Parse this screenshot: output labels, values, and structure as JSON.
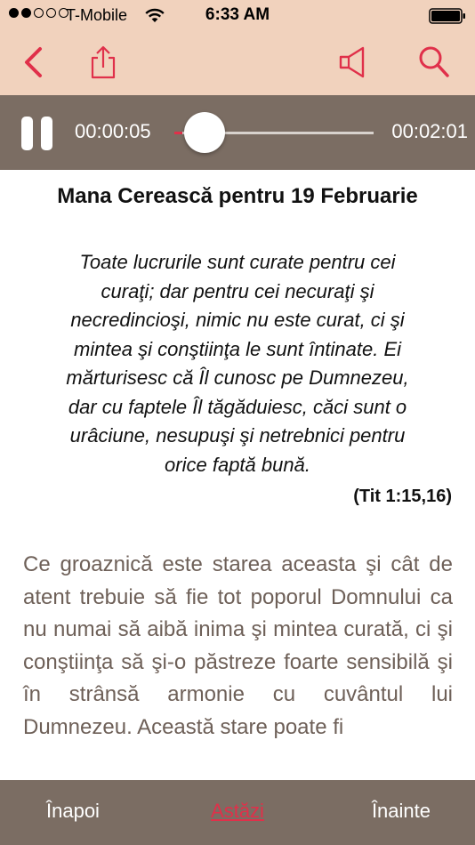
{
  "status_bar": {
    "carrier": "T-Mobile",
    "time": "6:33 AM",
    "signal_bars_filled": 2,
    "signal_bars_total": 5
  },
  "nav": {
    "icons": [
      "back-chevron-icon",
      "share-icon",
      "speaker-icon",
      "search-icon"
    ],
    "accent_color": "#e0304a"
  },
  "player": {
    "elapsed": "00:00:05",
    "duration": "00:02:01",
    "progress_fraction": 0.04
  },
  "article": {
    "title": "Mana Cerească pentru 19 Februarie",
    "verse_lines": [
      "Toate lucrurile sunt curate pentru cei",
      "curaţi; dar pentru cei necuraţi şi",
      "necredincioşi, nimic nu este curat, ci şi",
      "mintea şi conştiinţa le sunt întinate. Ei",
      "mărturisesc că Îl cunosc pe Dumnezeu,",
      "dar cu faptele Îl tăgăduiesc, căci sunt o",
      "urâciune, nesupuşi şi netrebnici pentru",
      "orice faptă bună."
    ],
    "reference": "(Tit 1:15,16)",
    "body_text": "Ce groaznică este starea aceasta şi cât de atent trebuie să fie tot poporul Domnului ca nu numai să aibă inima şi mintea curată, ci şi conştiinţa să şi-o păstreze foarte sensibilă şi în strânsă armonie cu cuvântul lui Dumnezeu. Această stare poate fi"
  },
  "toolbar": {
    "prev_label": "Înapoi",
    "today_label": "Astăzi",
    "next_label": "Înainte"
  },
  "colors": {
    "header_bg": "#f1d2bd",
    "bar_bg": "#7b6d63",
    "body_text": "#6e6058"
  }
}
